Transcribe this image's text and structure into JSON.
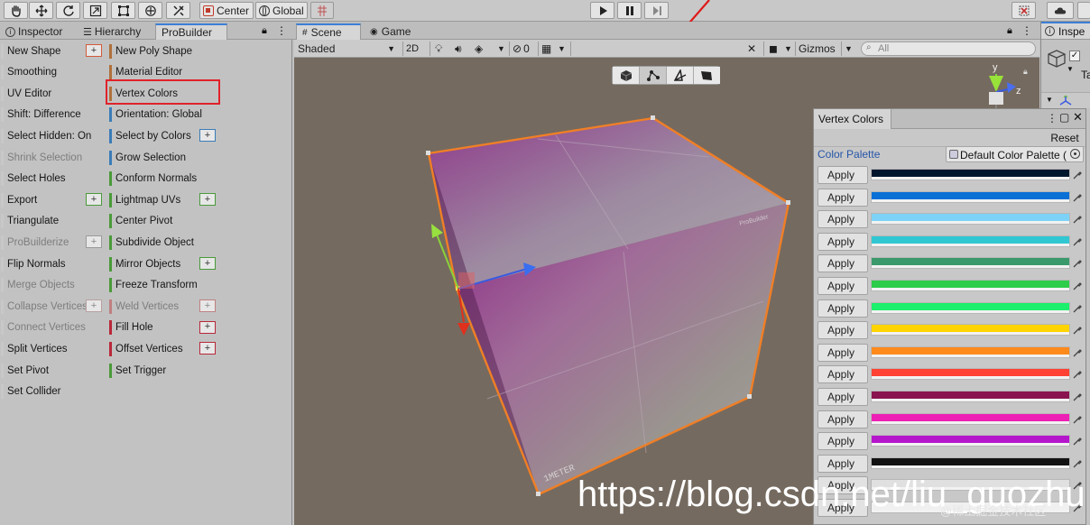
{
  "toolbar": {
    "pivot_label": "Center",
    "space_label": "Global",
    "tools": [
      "hand-icon",
      "move-icon",
      "rotate-icon",
      "scale-icon",
      "rect-icon",
      "transform-icon",
      "custom-tool-icon"
    ],
    "play_controls": [
      "play-icon",
      "pause-icon",
      "step-icon"
    ]
  },
  "left_tabs": {
    "inspector": "Inspector",
    "hierarchy": "Hierarchy",
    "probuilder": "ProBuilder"
  },
  "probuilder": {
    "left_column": [
      {
        "label": "New Shape",
        "enabled": true,
        "bar": "#c8c8c8",
        "plus": true,
        "plus_color": "#d35a3a"
      },
      {
        "label": "Smoothing",
        "enabled": true,
        "bar": "#c8c8c8",
        "plus": false
      },
      {
        "label": "UV Editor",
        "enabled": true,
        "bar": "#c8c8c8",
        "plus": false
      },
      {
        "label": "Shift: Difference",
        "enabled": true,
        "bar": "#c8c8c8",
        "plus": false
      },
      {
        "label": "Select Hidden: On",
        "enabled": true,
        "bar": "#c8c8c8",
        "plus": false
      },
      {
        "label": "Shrink Selection",
        "enabled": false,
        "bar": "#c8c8c8",
        "plus": false
      },
      {
        "label": "Select Holes",
        "enabled": true,
        "bar": "#c8c8c8",
        "plus": false
      },
      {
        "label": "Export",
        "enabled": true,
        "bar": "#c8c8c8",
        "plus": true,
        "plus_color": "#4a9a3a"
      },
      {
        "label": "Triangulate",
        "enabled": true,
        "bar": "#c8c8c8",
        "plus": false
      },
      {
        "label": "ProBuilderize",
        "enabled": false,
        "bar": "#c8c8c8",
        "plus": true,
        "plus_color": "#9a9a9a"
      },
      {
        "label": "Flip Normals",
        "enabled": true,
        "bar": "#c8c8c8",
        "plus": false
      },
      {
        "label": "Merge Objects",
        "enabled": false,
        "bar": "#c8c8c8",
        "plus": false
      },
      {
        "label": "Collapse Vertices",
        "enabled": false,
        "bar": "#c8c8c8",
        "plus": true,
        "plus_color": "#b8a0a0"
      },
      {
        "label": "Connect Vertices",
        "enabled": false,
        "bar": "#c8c8c8",
        "plus": false
      },
      {
        "label": "Split Vertices",
        "enabled": true,
        "bar": "#c8c8c8",
        "plus": false
      },
      {
        "label": "Set Pivot",
        "enabled": true,
        "bar": "#c8c8c8",
        "plus": false
      },
      {
        "label": "Set Collider",
        "enabled": true,
        "bar": "#c8c8c8",
        "plus": false
      }
    ],
    "right_column": [
      {
        "label": "New Poly Shape",
        "enabled": true,
        "bar": "#b0703a",
        "plus": false
      },
      {
        "label": "Material Editor",
        "enabled": true,
        "bar": "#b0703a",
        "plus": false
      },
      {
        "label": "Vertex Colors",
        "enabled": true,
        "bar": "#b0703a",
        "plus": false,
        "highlight": true
      },
      {
        "label": "Orientation: Global",
        "enabled": true,
        "bar": "#3a7cb8",
        "plus": false
      },
      {
        "label": "Select by Colors",
        "enabled": true,
        "bar": "#3a7cb8",
        "plus": true,
        "plus_color": "#3a7cb8"
      },
      {
        "label": "Grow Selection",
        "enabled": true,
        "bar": "#3a7cb8",
        "plus": false
      },
      {
        "label": "Conform Normals",
        "enabled": true,
        "bar": "#4a9a3a",
        "plus": false
      },
      {
        "label": "Lightmap UVs",
        "enabled": true,
        "bar": "#4a9a3a",
        "plus": true,
        "plus_color": "#4a9a3a"
      },
      {
        "label": "Center Pivot",
        "enabled": true,
        "bar": "#4a9a3a",
        "plus": false
      },
      {
        "label": "Subdivide Object",
        "enabled": true,
        "bar": "#4a9a3a",
        "plus": false
      },
      {
        "label": "Mirror Objects",
        "enabled": true,
        "bar": "#4a9a3a",
        "plus": true,
        "plus_color": "#4a9a3a"
      },
      {
        "label": "Freeze Transform",
        "enabled": true,
        "bar": "#4a9a3a",
        "plus": false
      },
      {
        "label": "Weld Vertices",
        "enabled": false,
        "bar": "#c08080",
        "plus": true,
        "plus_color": "#c08080"
      },
      {
        "label": "Fill Hole",
        "enabled": true,
        "bar": "#b8283a",
        "plus": true,
        "plus_color": "#b8283a"
      },
      {
        "label": "Offset Vertices",
        "enabled": true,
        "bar": "#b8283a",
        "plus": true,
        "plus_color": "#b8283a"
      },
      {
        "label": "Set Trigger",
        "enabled": true,
        "bar": "#4a9a3a",
        "plus": false
      }
    ]
  },
  "scene_tabs": {
    "scene": "Scene",
    "game": "Game"
  },
  "scene_toolbar": {
    "draw_mode": "Shaded",
    "two_d": "2D",
    "hidden_count": "0",
    "gizmos": "Gizmos",
    "search_placeholder": "All"
  },
  "axis_labels": {
    "y": "y",
    "z": "z"
  },
  "cube_label": "1METER",
  "cube_label_small": "ProBuilder",
  "vertex_colors": {
    "title": "Vertex Colors",
    "reset": "Reset",
    "palette_label": "Color Palette",
    "palette_value": "Default Color Palette (",
    "apply_label": "Apply",
    "colors": [
      "#00172e",
      "#0a70d6",
      "#7dd3f7",
      "#31c7d2",
      "#3a9a6c",
      "#2dcc4a",
      "#1cf06c",
      "#ffd400",
      "#ff8a1c",
      "#ff4234",
      "#8a1450",
      "#ed1fb4",
      "#b516cc",
      "#121212",
      "#e0e0e0",
      "#f0f0f0"
    ]
  },
  "right_inspector": {
    "tab": "Inspe",
    "text": "Ta"
  },
  "watermark": "https://blog.csdn.net/liu_guozhu",
  "watermark_small": "@稀土掘金技术社区"
}
